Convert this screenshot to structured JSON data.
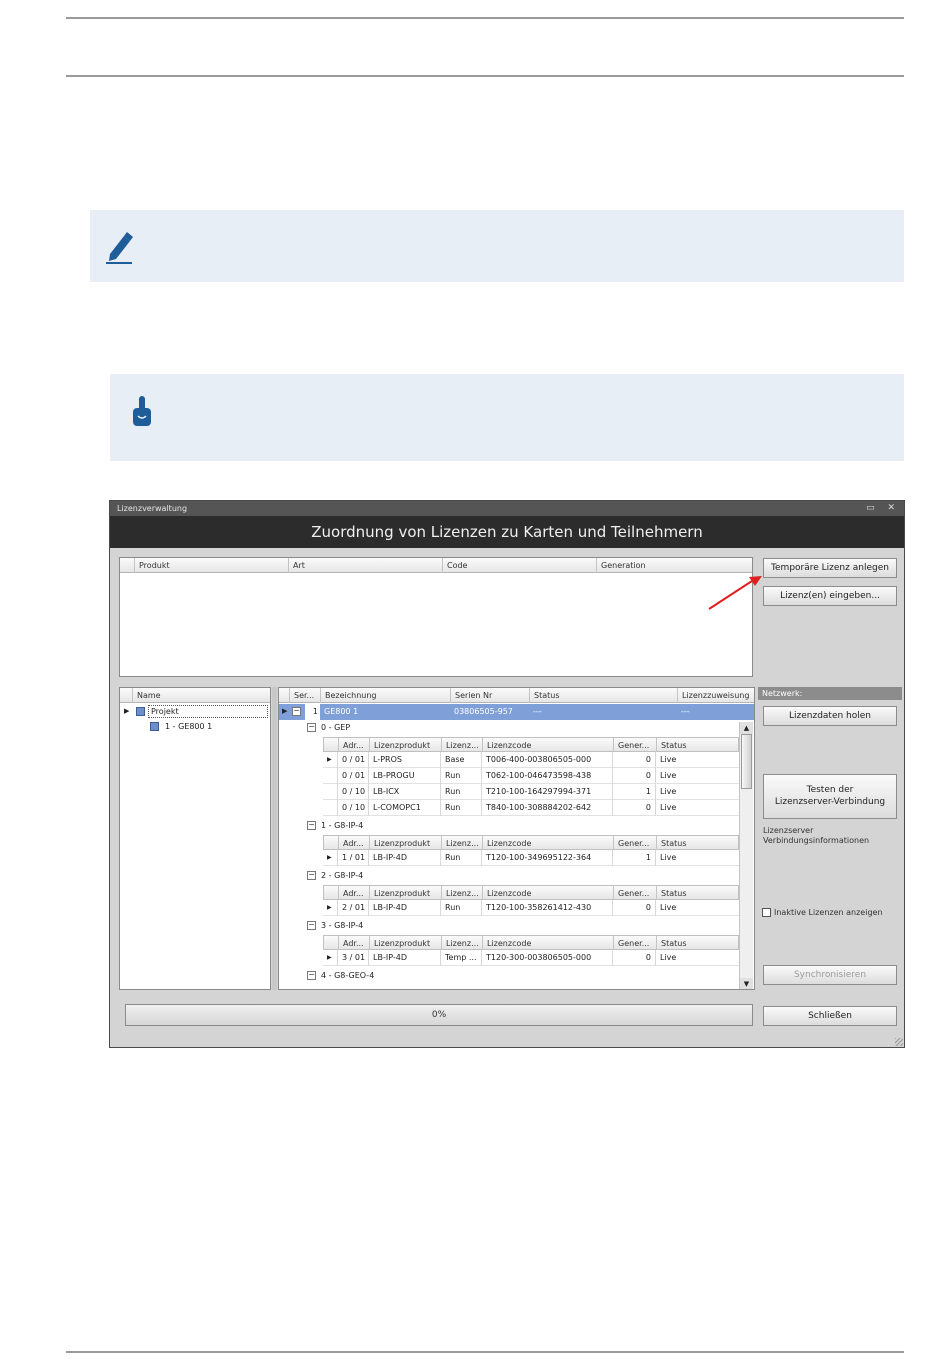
{
  "window": {
    "title": "Lizenzverwaltung",
    "controls": "▭ ✕",
    "banner": "Zuordnung von Lizenzen zu Karten und Teilnehmern"
  },
  "top_grid": {
    "columns": [
      "Produkt",
      "Art",
      "Code",
      "Generation"
    ]
  },
  "buttons": {
    "temp_license": "Temporäre Lizenz anlegen",
    "enter_license": "Lizenz(en) eingeben...",
    "get_license_data": "Lizenzdaten holen",
    "test_connection_line1": "Testen der",
    "test_connection_line2": "Lizenzserver-Verbindung",
    "synchronize": "Synchronisieren",
    "close": "Schließen"
  },
  "network": {
    "header": "Netzwerk:",
    "info_line1": "Lizenzserver",
    "info_line2": "Verbindungsinformationen",
    "inactive_checkbox_label": "Inaktive Lizenzen anzeigen"
  },
  "tree": {
    "column": "Name",
    "root": "Projekt",
    "child": "1 - GE800 1"
  },
  "device_grid": {
    "columns": [
      "Ser...",
      "Bezeichnung",
      "Serien Nr",
      "Status",
      "Lizenzzuweisung"
    ],
    "row": {
      "ser": "1",
      "bezeichnung": "GE800 1",
      "serien_nr": "03806505-957",
      "status": "---",
      "zuweisung": "---"
    }
  },
  "license_groups": {
    "columns": [
      "Adr...",
      "Lizenzprodukt",
      "Lizenz...",
      "Lizenzcode",
      "Gener...",
      "Status"
    ],
    "groups": [
      {
        "title": "0 - GEP",
        "rows": [
          [
            "0 / 01",
            "L-PROS",
            "Base",
            "T006-400-003806505-000",
            "0",
            "Live"
          ],
          [
            "0 / 01",
            "LB-PROGU",
            "Run",
            "T062-100-046473598-438",
            "0",
            "Live"
          ],
          [
            "0 / 10",
            "LB-ICX",
            "Run",
            "T210-100-164297994-371",
            "1",
            "Live"
          ],
          [
            "0 / 10",
            "L-COMOPC1",
            "Run",
            "T840-100-308884202-642",
            "0",
            "Live"
          ]
        ]
      },
      {
        "title": "1 - G8-IP-4",
        "rows": [
          [
            "1 / 01",
            "LB-IP-4D",
            "Run",
            "T120-100-349695122-364",
            "1",
            "Live"
          ]
        ]
      },
      {
        "title": "2 - G8-IP-4",
        "rows": [
          [
            "2 / 01",
            "LB-IP-4D",
            "Run",
            "T120-100-358261412-430",
            "0",
            "Live"
          ]
        ]
      },
      {
        "title": "3 - G8-IP-4",
        "rows": [
          [
            "3 / 01",
            "LB-IP-4D",
            "Temp ...",
            "T120-300-003806505-000",
            "0",
            "Live"
          ]
        ]
      },
      {
        "title": "4 - G8-GEO-4",
        "rows": []
      }
    ]
  },
  "progress": {
    "value": 0,
    "label": "0%"
  },
  "colors": {
    "note_bg": "#e8eef6",
    "icon_blue": "#1f5d9a",
    "selection": "#7f9fd8",
    "banner": "#2c2c2c",
    "arrow": "#e02020"
  },
  "icons": [
    "pencil-note-icon",
    "pointing-hand-icon"
  ]
}
